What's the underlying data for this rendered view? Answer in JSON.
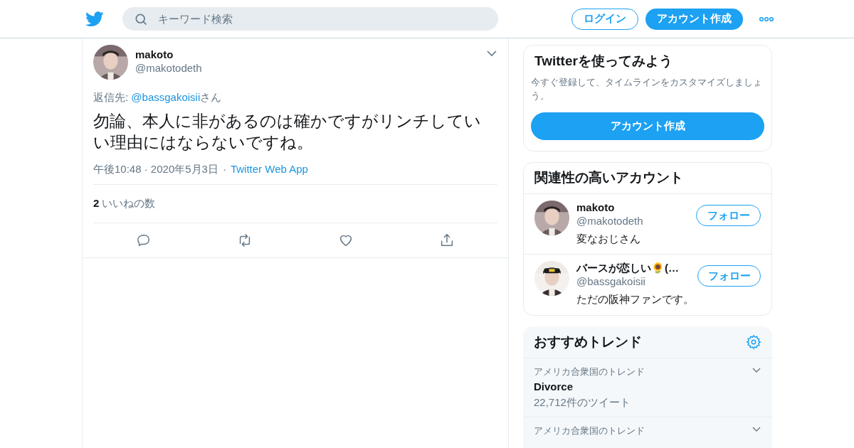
{
  "header": {
    "search": {
      "placeholder": "キーワード検索"
    },
    "login": "ログイン",
    "signup": "アカウント作成"
  },
  "tweet": {
    "name": "makoto",
    "handle": "@makotodeth",
    "reply_label": "返信先: ",
    "reply_to": "@bassgakoisii",
    "reply_suffix": "さん",
    "text": "勿論、本人に非があるのは確かですがリンチしていい理由にはならないですね。",
    "time": "午後10:48 · 2020年5月3日",
    "separator": "·",
    "source": "Twitter Web App",
    "likes_count": "2",
    "likes_label": "いいねの数"
  },
  "signup_card": {
    "title": "Twitterを使ってみよう",
    "description": "今すぐ登録して、タイムラインをカスタマイズしましょう。",
    "button": "アカウント作成"
  },
  "related": {
    "title": "関連性の高いアカウント",
    "accounts": [
      {
        "name": "makoto",
        "handle": "@makotodeth",
        "bio": "変なおじさん",
        "follow": "フォロー"
      },
      {
        "name": "バースが恋しい🌻(…",
        "handle": "@bassgakoisii",
        "bio": "ただの阪神ファンです。",
        "follow": "フォロー"
      }
    ]
  },
  "trends": {
    "title": "おすすめトレンド",
    "items": [
      {
        "context": "アメリカ合衆国のトレンド",
        "name": "Divorce",
        "count": "22,712件のツイート"
      },
      {
        "context": "アメリカ合衆国のトレンド"
      }
    ]
  }
}
